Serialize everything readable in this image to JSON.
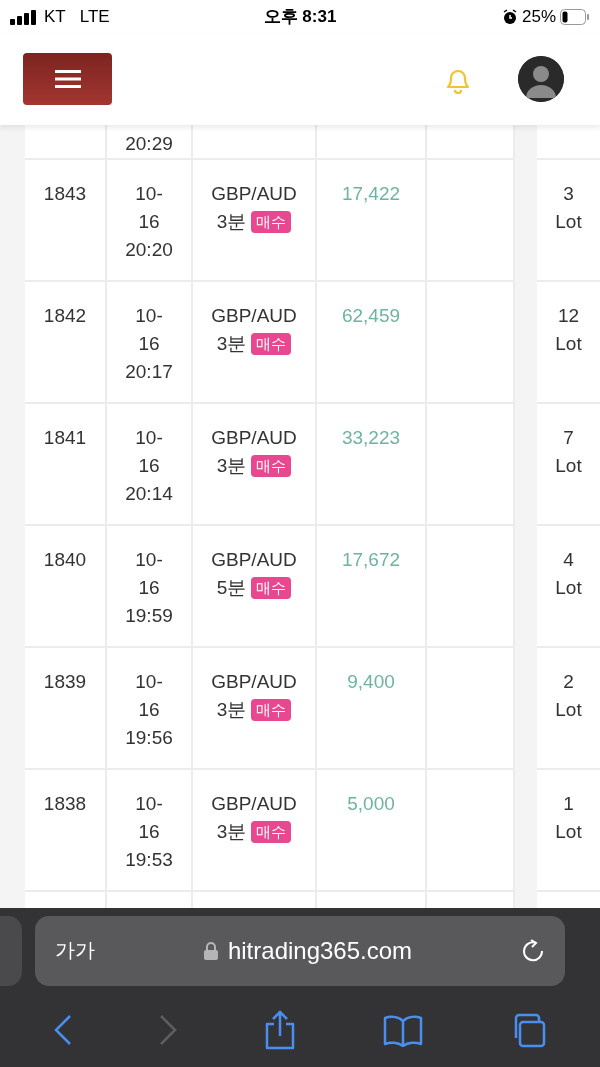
{
  "status_bar": {
    "carrier": "KT",
    "network": "LTE",
    "time": "오후 8:31",
    "battery_text": "25%"
  },
  "header": {
    "notifications": true
  },
  "table": {
    "partial_top_row": {
      "time": "20:29"
    },
    "rows": [
      {
        "no": "1843",
        "date": "10-16",
        "time": "20:20",
        "pair": "GBP/AUD",
        "period": "3분",
        "side": "매수",
        "amount": "17,422",
        "lot": "3 Lot"
      },
      {
        "no": "1842",
        "date": "10-16",
        "time": "20:17",
        "pair": "GBP/AUD",
        "period": "3분",
        "side": "매수",
        "amount": "62,459",
        "lot": "12 Lot"
      },
      {
        "no": "1841",
        "date": "10-16",
        "time": "20:14",
        "pair": "GBP/AUD",
        "period": "3분",
        "side": "매수",
        "amount": "33,223",
        "lot": "7 Lot"
      },
      {
        "no": "1840",
        "date": "10-16",
        "time": "19:59",
        "pair": "GBP/AUD",
        "period": "5분",
        "side": "매수",
        "amount": "17,672",
        "lot": "4 Lot"
      },
      {
        "no": "1839",
        "date": "10-16",
        "time": "19:56",
        "pair": "GBP/AUD",
        "period": "3분",
        "side": "매수",
        "amount": "9,400",
        "lot": "2 Lot"
      },
      {
        "no": "1838",
        "date": "10-16",
        "time": "19:53",
        "pair": "GBP/AUD",
        "period": "3분",
        "side": "매수",
        "amount": "5,000",
        "lot": "1 Lot"
      }
    ]
  },
  "browser": {
    "text_size": "가가",
    "url": "hitrading365.com",
    "forward_disabled": true
  }
}
